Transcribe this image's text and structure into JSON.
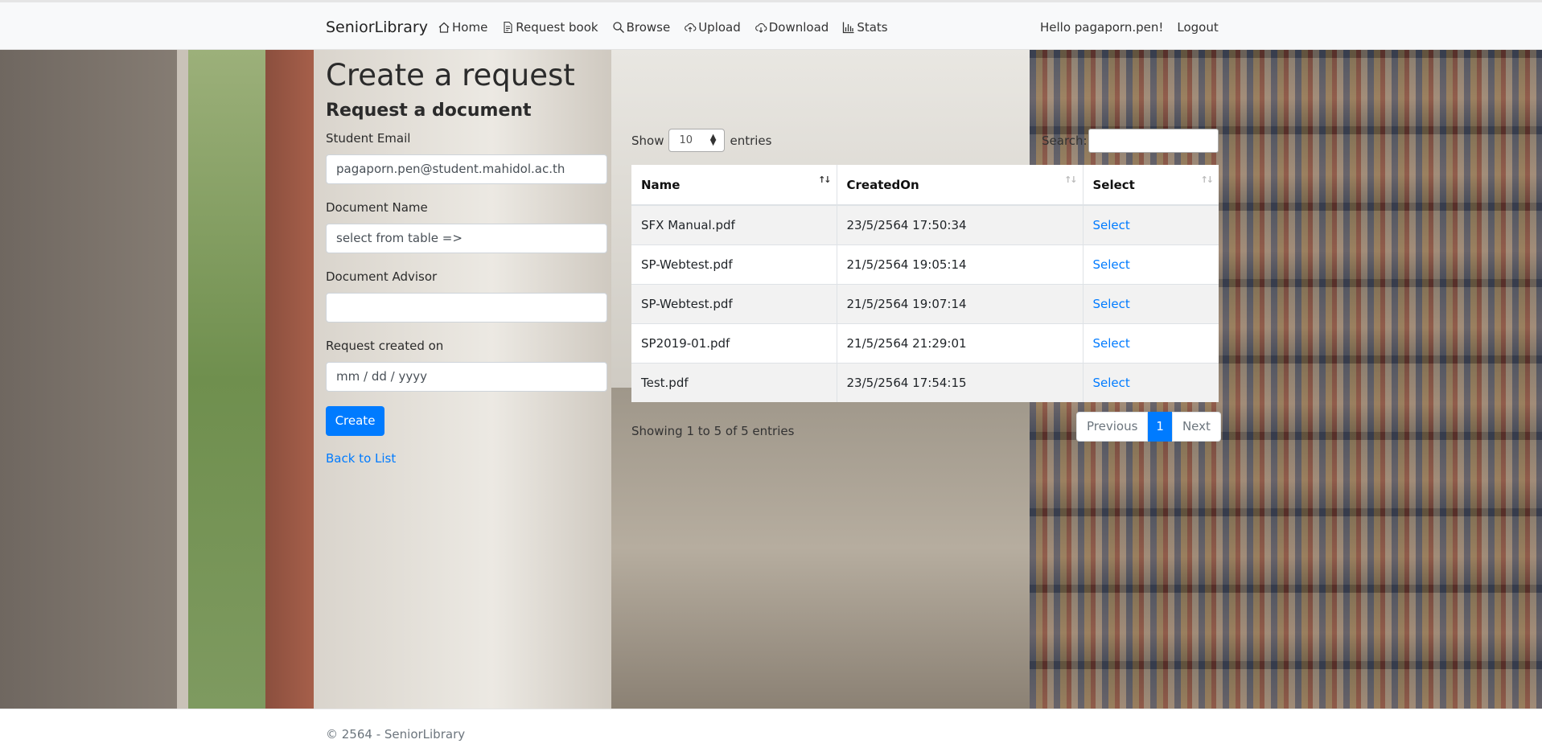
{
  "navbar": {
    "brand": "SeniorLibrary",
    "links": [
      {
        "label": "Home",
        "icon": "house-icon"
      },
      {
        "label": "Request book",
        "icon": "file-text-icon"
      },
      {
        "label": "Browse",
        "icon": "search-icon"
      },
      {
        "label": "Upload",
        "icon": "cloud-upload-icon"
      },
      {
        "label": "Download",
        "icon": "cloud-download-icon"
      },
      {
        "label": "Stats",
        "icon": "bar-chart-icon"
      }
    ],
    "greeting": "Hello pagaporn.pen!",
    "logout": "Logout"
  },
  "form": {
    "title": "Create a request",
    "subtitle": "Request a document",
    "email_label": "Student Email",
    "email_value": "pagaporn.pen@student.mahidol.ac.th",
    "docname_label": "Document Name",
    "docname_value": "select from table =>",
    "advisor_label": "Document Advisor",
    "advisor_value": "",
    "created_label": "Request created on",
    "created_placeholder": "mm / dd / yyyy",
    "create_button": "Create",
    "back_link": "Back to List"
  },
  "table": {
    "show_label": "Show",
    "entries_label": "entries",
    "page_size": "10",
    "search_label": "Search:",
    "columns": [
      "Name",
      "CreatedOn",
      "Select"
    ],
    "rows": [
      {
        "name": "SFX Manual.pdf",
        "created": "23/5/2564 17:50:34",
        "select": "Select"
      },
      {
        "name": "SP-Webtest.pdf",
        "created": "21/5/2564 19:05:14",
        "select": "Select"
      },
      {
        "name": "SP-Webtest.pdf",
        "created": "21/5/2564 19:07:14",
        "select": "Select"
      },
      {
        "name": "SP2019-01.pdf",
        "created": "21/5/2564 21:29:01",
        "select": "Select"
      },
      {
        "name": "Test.pdf",
        "created": "23/5/2564 17:54:15",
        "select": "Select"
      }
    ],
    "info": "Showing 1 to 5 of 5 entries",
    "pager": {
      "previous": "Previous",
      "current": "1",
      "next": "Next"
    }
  },
  "footer": {
    "text": "© 2564 - SeniorLibrary"
  },
  "colors": {
    "accent": "#007bff",
    "navbar_bg": "#f8f9fa"
  }
}
